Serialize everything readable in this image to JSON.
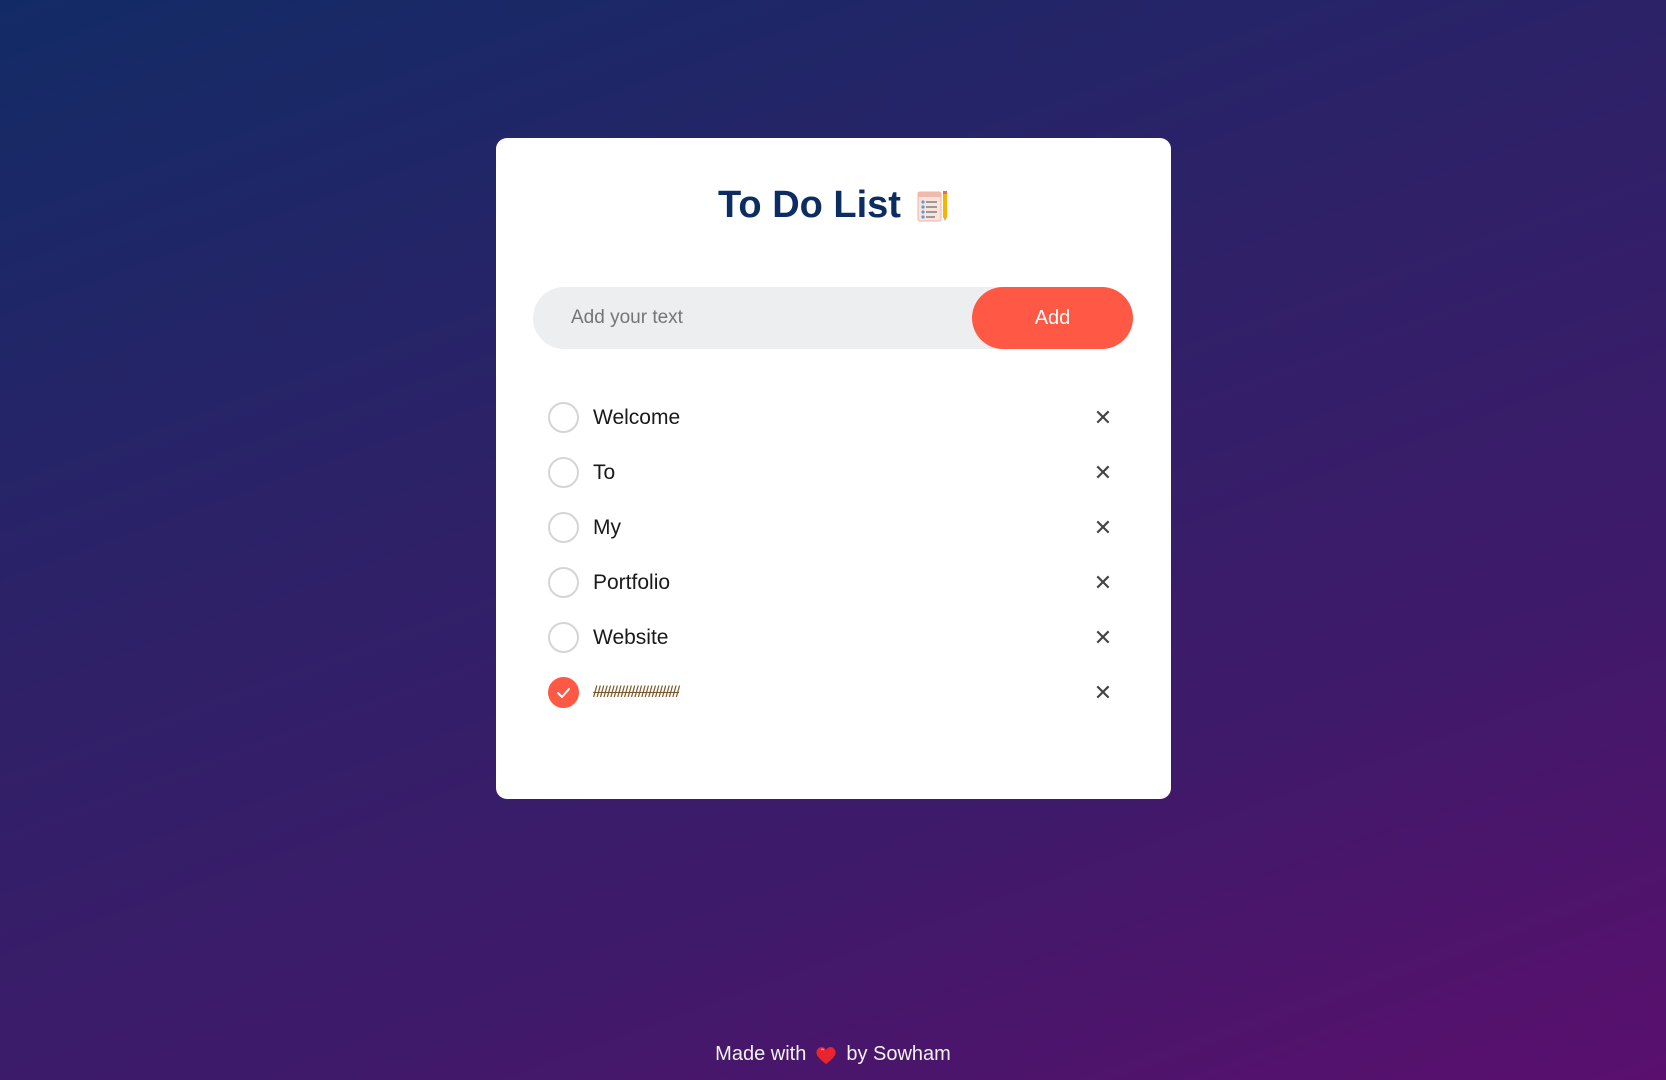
{
  "header": {
    "title": "To Do List",
    "icon": "notepad-icon"
  },
  "input": {
    "placeholder": "Add your text",
    "value": "",
    "add_label": "Add"
  },
  "tasks": [
    {
      "label": "Welcome",
      "checked": false
    },
    {
      "label": "To",
      "checked": false
    },
    {
      "label": "My",
      "checked": false
    },
    {
      "label": "Portfolio",
      "checked": false
    },
    {
      "label": "Website",
      "checked": false
    },
    {
      "label": "/////////////////////////",
      "checked": true
    }
  ],
  "footer": {
    "prefix": "Made with",
    "icon": "heart-icon",
    "suffix": "by Sowham"
  },
  "colors": {
    "accent": "#ff5945",
    "title": "#0c2d62",
    "card": "#ffffff",
    "input_bg": "#edeef0"
  }
}
